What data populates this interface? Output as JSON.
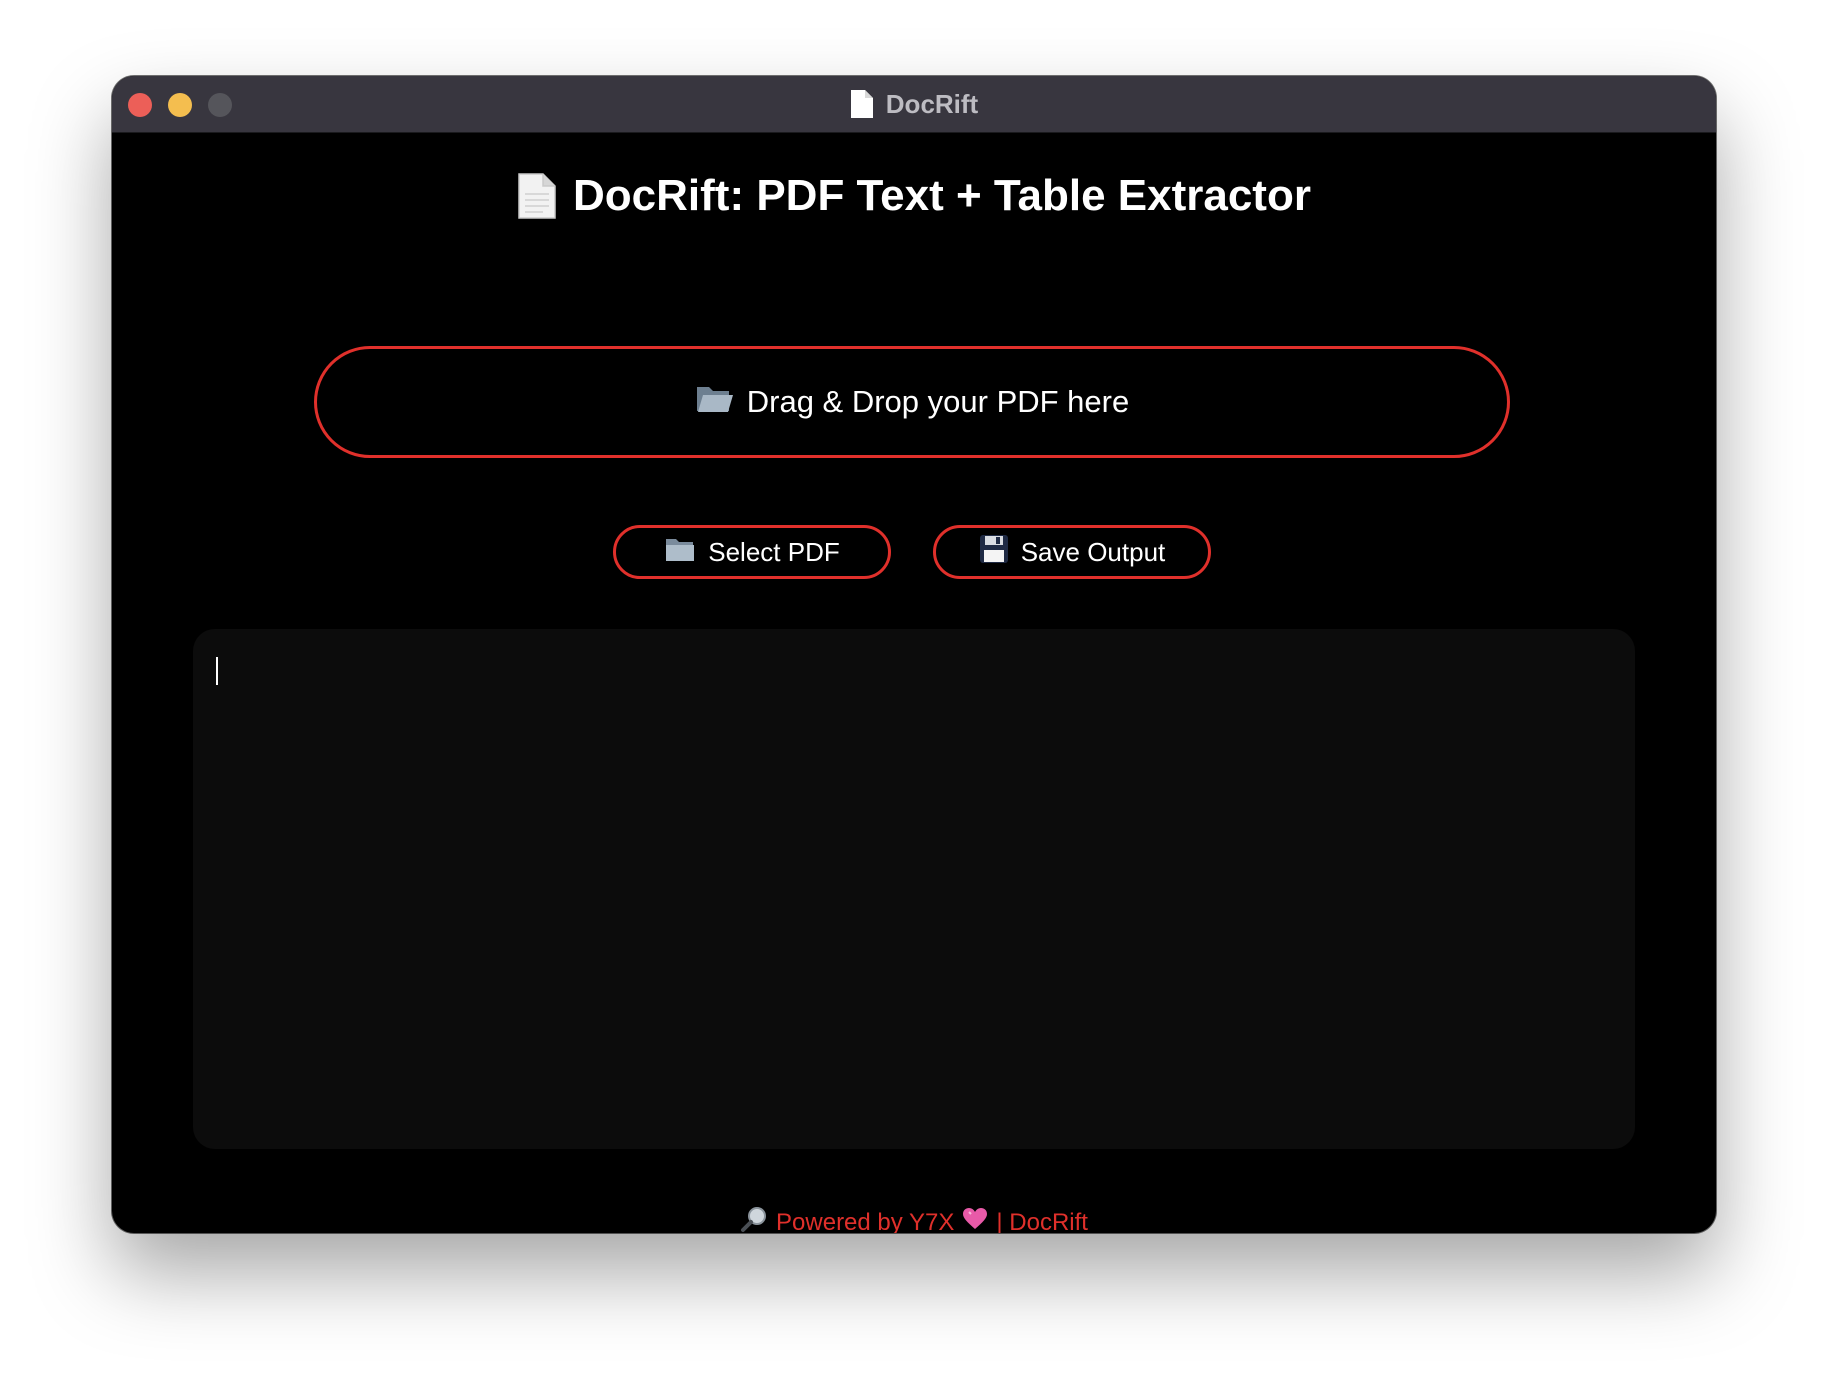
{
  "window": {
    "title": "DocRift",
    "title_icon": "document-icon"
  },
  "main": {
    "heading": "DocRift: PDF Text + Table Extractor",
    "heading_icon": "document-icon",
    "dropzone_label": "Drag & Drop your PDF here",
    "dropzone_icon": "open-folder-icon",
    "select_button_label": "Select PDF",
    "select_button_icon": "folder-icon",
    "save_button_label": "Save Output",
    "save_button_icon": "floppy-disk-icon",
    "output_text": ""
  },
  "footer": {
    "powered_by": "Powered by Y7X",
    "separator_suffix": "| DocRift",
    "icon_left": "magnifier-icon",
    "icon_heart": "heart-icon"
  },
  "colors": {
    "accent": "#e0302b",
    "background": "#000000",
    "output_bg": "#0c0c0c",
    "titlebar": "#38363f"
  }
}
